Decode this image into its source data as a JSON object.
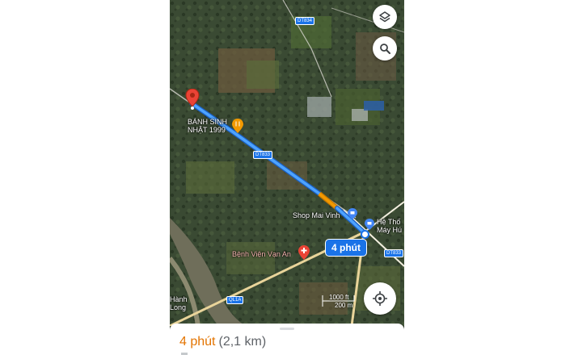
{
  "map": {
    "road_labels": {
      "dt834": "DT834",
      "dt833_a": "DT833",
      "dt833_b": "DT833",
      "ql1a": "QL1A"
    },
    "place_labels": {
      "destination": "BÁNH SINH NHẬT 1999",
      "shop": "Shop Mai Vinh",
      "hospital": "Bệnh Viện Vạn An",
      "right_poi": "Hệ Thố\nMáy Hú",
      "bottom_left": "Hành\nLong"
    },
    "route_time_chip": "4 phút",
    "scale": {
      "top": "1000 ft",
      "bottom": "200 m"
    }
  },
  "controls": {
    "layers": "layers-icon",
    "search": "search-icon",
    "locate": "my-location-icon"
  },
  "sheet": {
    "eta_time": "4 phút",
    "eta_distance": "(2,1 km)"
  },
  "colors": {
    "route": "#4285f4",
    "traffic_slow": "#f29900",
    "eta": "#e37400",
    "pin": "#ea4335"
  }
}
